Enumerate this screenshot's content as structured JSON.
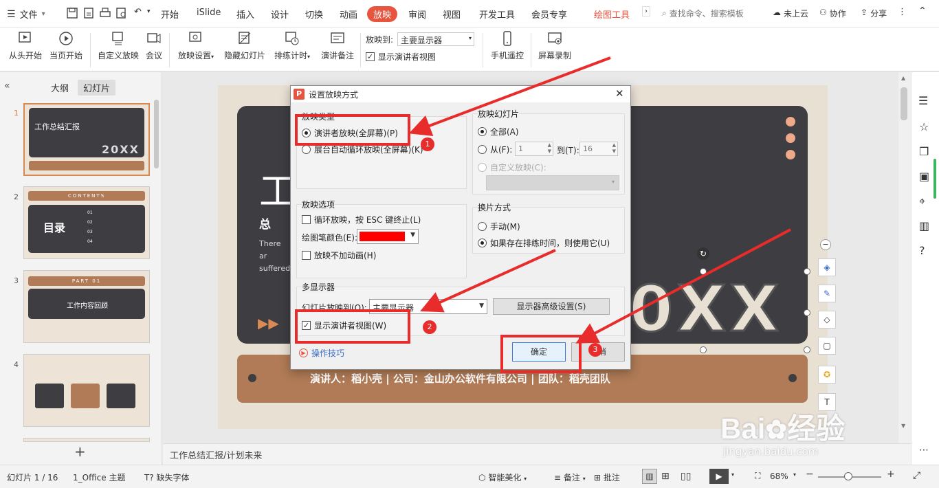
{
  "menubar": {
    "file_label": "文件",
    "tabs": [
      "开始",
      "iSlide",
      "插入",
      "设计",
      "切换",
      "动画",
      "放映",
      "审阅",
      "视图",
      "开发工具",
      "会员专享"
    ],
    "active_tab": "放映",
    "context_tab": "绘图工具",
    "search_placeholder": "查找命令、搜索模板",
    "cloud": "未上云",
    "collab": "协作",
    "share": "分享"
  },
  "ribbon": {
    "from_start": "从头开始",
    "from_current": "当页开始",
    "custom_show": "自定义放映",
    "meeting": "会议",
    "show_settings": "放映设置",
    "hide_slide": "隐藏幻灯片",
    "rehearse": "排练计时",
    "speaker_notes": "演讲备注",
    "play_to_label": "放映到:",
    "play_to_value": "主要显示器",
    "presenter_view": "显示演讲者视图",
    "phone_remote": "手机遥控",
    "screen_record": "屏幕录制"
  },
  "leftpanel": {
    "tab_outline": "大纲",
    "tab_slides": "幻灯片",
    "slides": [
      {
        "num": "1",
        "title": "工作总结汇报",
        "year": "20XX"
      },
      {
        "num": "2",
        "header": "CONTENTS",
        "title": "目录",
        "items": [
          "01",
          "02",
          "03",
          "04"
        ]
      },
      {
        "num": "3",
        "header": "PART 01",
        "title": "工作内容回顾"
      },
      {
        "num": "4"
      }
    ],
    "add_slide": "+"
  },
  "slide": {
    "title_char": "工",
    "subtitle_chars": "总 结",
    "body_text": "There ar suffered",
    "year": "20XX",
    "footer": "演讲人：稻小壳  |  公司：金山办公软件有限公司  |  团队：稻壳团队"
  },
  "notes": "工作总结汇报/计划未来",
  "dialog": {
    "title": "设置放映方式",
    "show_type": {
      "label": "放映类型",
      "options": [
        "演讲者放映(全屏幕)(P)",
        "展台自动循环放映(全屏幕)(K)"
      ],
      "selected": 0
    },
    "slides_range": {
      "label": "放映幻灯片",
      "all": "全部(A)",
      "from": "从(F):",
      "from_value": "1",
      "to": "到(T):",
      "to_value": "16",
      "custom": "自定义放映(C):"
    },
    "show_options": {
      "label": "放映选项",
      "loop": "循环放映，按 ESC 键终止(L)",
      "pen_color": "绘图笔颜色(E):",
      "pen_color_value": "#ff0000",
      "no_animation": "放映不加动画(H)"
    },
    "advance": {
      "label": "换片方式",
      "manual": "手动(M)",
      "timings": "如果存在排练时间，则使用它(U)"
    },
    "monitors": {
      "label": "多显示器",
      "play_to": "幻灯片放映到(O):",
      "play_to_value": "主要显示器",
      "advanced": "显示器高级设置(S)",
      "presenter_view": "显示演讲者视图(W)"
    },
    "tips": "操作技巧",
    "ok": "确定",
    "cancel": "取消"
  },
  "annotations": [
    "1",
    "2",
    "3"
  ],
  "statusbar": {
    "slide_info": "幻灯片 1 / 16",
    "theme": "1_Office 主题",
    "missing_font": "缺失字体",
    "smart": "智能美化",
    "notes": "备注",
    "comments": "批注",
    "zoom": "68%"
  },
  "colors": {
    "accent": "#e8553f",
    "slide_dark": "#3e3d42",
    "slide_brown": "#b07b56",
    "slide_bg": "#e9e0d4",
    "annotation_red": "#e82c2c"
  }
}
